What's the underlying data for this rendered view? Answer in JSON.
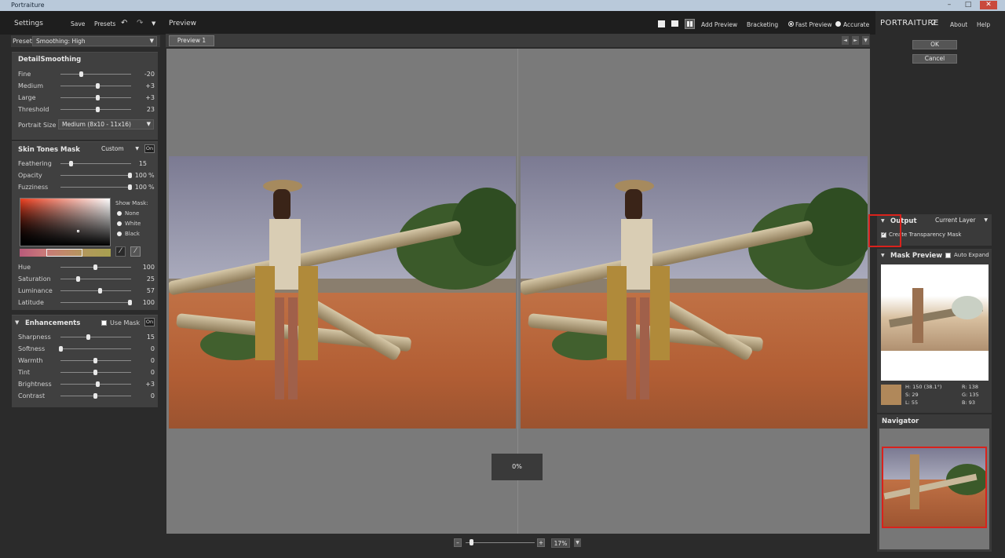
{
  "window": {
    "title": "Portraiture",
    "minimize": "–",
    "maximize": "□",
    "close": "✕"
  },
  "settings": {
    "title": "Settings",
    "save_label": "Save",
    "presets_label": "Presets",
    "undo_icon": "↶",
    "redo_icon": "↷",
    "menu_icon": "▼",
    "preset_label": "Preset",
    "preset_value": "Smoothing: High"
  },
  "detail": {
    "title": "DetailSmoothing",
    "sliders": [
      {
        "label": "Fine",
        "value": "-20",
        "pos": 0.3
      },
      {
        "label": "Medium",
        "value": "+3",
        "pos": 0.53
      },
      {
        "label": "Large",
        "value": "+3",
        "pos": 0.53
      },
      {
        "label": "Threshold",
        "value": "23",
        "pos": 0.53
      }
    ],
    "portrait_size_label": "Portrait Size",
    "portrait_size_value": "Medium (8x10 - 11x16)"
  },
  "skin": {
    "title": "Skin Tones Mask",
    "mode": "Custom",
    "on_label": "On",
    "sliders": [
      {
        "label": "Feathering",
        "value": "15",
        "unit": "",
        "pos": 0.15
      },
      {
        "label": "Opacity",
        "value": "100",
        "unit": "%",
        "pos": 1.0
      },
      {
        "label": "Fuzziness",
        "value": "100",
        "unit": "%",
        "pos": 1.0
      }
    ],
    "show_mask_label": "Show Mask:",
    "show_mask_options": [
      "None",
      "White",
      "Black"
    ],
    "hsl_sliders": [
      {
        "label": "Hue",
        "value": "100",
        "pos": 0.5
      },
      {
        "label": "Saturation",
        "value": "25",
        "pos": 0.25
      },
      {
        "label": "Luminance",
        "value": "57",
        "pos": 0.57
      },
      {
        "label": "Latitude",
        "value": "100",
        "pos": 1.0
      }
    ]
  },
  "enhance": {
    "title": "Enhancements",
    "use_mask_label": "Use Mask",
    "on_label": "On",
    "sliders": [
      {
        "label": "Sharpness",
        "value": "15",
        "pos": 0.4
      },
      {
        "label": "Softness",
        "value": "0",
        "pos": 0.0
      },
      {
        "label": "Warmth",
        "value": "0",
        "pos": 0.5
      },
      {
        "label": "Tint",
        "value": "0",
        "pos": 0.5
      },
      {
        "label": "Brightness",
        "value": "+3",
        "pos": 0.53
      },
      {
        "label": "Contrast",
        "value": "0",
        "pos": 0.5
      }
    ]
  },
  "preview": {
    "title": "Preview",
    "tab_label": "Preview 1",
    "add_preview": "Add Preview",
    "bracketing": "Bracketing",
    "fast_preview": "Fast Preview",
    "accurate": "Accurate",
    "progress": "0%",
    "zoom": "17%",
    "zoom_minus": "–",
    "zoom_plus": "+",
    "prev_icon": "◄",
    "next_icon": "►",
    "tab_menu_icon": "▼"
  },
  "right": {
    "brand": "PORTRAITURE",
    "version": "2",
    "about": "About",
    "help": "Help",
    "ok": "OK",
    "cancel": "Cancel",
    "output_label": "Output",
    "output_value": "Current Layer",
    "create_mask": "Create Transparency Mask",
    "mask_preview_label": "Mask Preview",
    "auto_expand": "Auto Expand",
    "swatch_color": "#b0885a",
    "color_h": "H: 150 (38.1°)",
    "color_s": "S: 29",
    "color_l": "L: 55",
    "color_r": "R: 138",
    "color_g": "G: 135",
    "color_b": "B: 93",
    "navigator_label": "Navigator"
  },
  "colors": {
    "accent_red": "#d9221c"
  }
}
